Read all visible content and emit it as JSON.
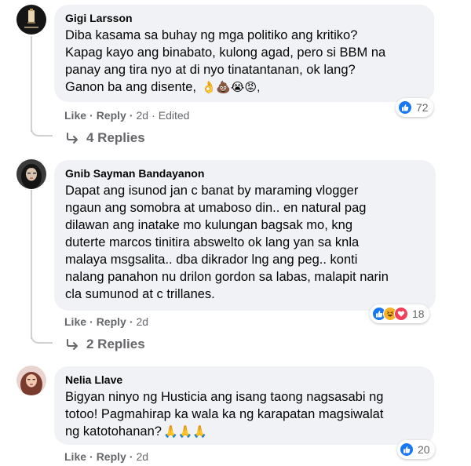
{
  "comments": [
    {
      "author": "Gigi Larsson",
      "lines": [
        "Diba kasama sa buhay ng mga politiko ang kritiko?",
        "Kapag kayo ang binabato, kulong agad, pero si BBM na",
        "panay ang tira nyo at di nyo tinatantanan, ok lang?",
        "Ganon ba ang disente,"
      ],
      "emojis": "👌💩😭😡,",
      "reaction_count": "72",
      "reactions": [
        "like"
      ],
      "like_label": "Like",
      "reply_label": "Reply",
      "time": "2d",
      "edited": "Edited",
      "replies_label": "4 Replies"
    },
    {
      "author": "Gnib Sayman Bandayanon",
      "lines": [
        "Dapat ang isunod jan c banat by maraming vlogger",
        "ngaun ang somobra at umaboso din.. en natural pag",
        "dilawan ang inatake mo kulungan bagsak mo, kng",
        "duterte marcos tinitira abswelto ok lang yan sa knla",
        "malaya msgsalita.. dba dikrador lng ang peg.. konti",
        "nalang panahon nu drilon gordon sa labas, malapit narin",
        "cla sumunod at c trillanes."
      ],
      "reaction_count": "18",
      "reactions": [
        "like",
        "haha",
        "love"
      ],
      "like_label": "Like",
      "reply_label": "Reply",
      "time": "2d",
      "replies_label": "2 Replies"
    },
    {
      "author": "Nelia Llave",
      "lines": [
        "Bigyan ninyo ng Husticia ang isang taong nagsasabi ng",
        "totoo! Pagmahirap ka wala ka ng karapatan magsiwalat",
        "ng katotohanan?"
      ],
      "emojis": "🙏🙏🙏",
      "reaction_count": "20",
      "reactions": [
        "like"
      ],
      "like_label": "Like",
      "reply_label": "Reply",
      "time": "2d"
    }
  ],
  "colors": {
    "bubble": "#f0f2f5",
    "meta": "#65676b",
    "like": "#1877f2",
    "love": "#f33e58",
    "haha": "#f7b125",
    "thread": "#ced0d4"
  }
}
